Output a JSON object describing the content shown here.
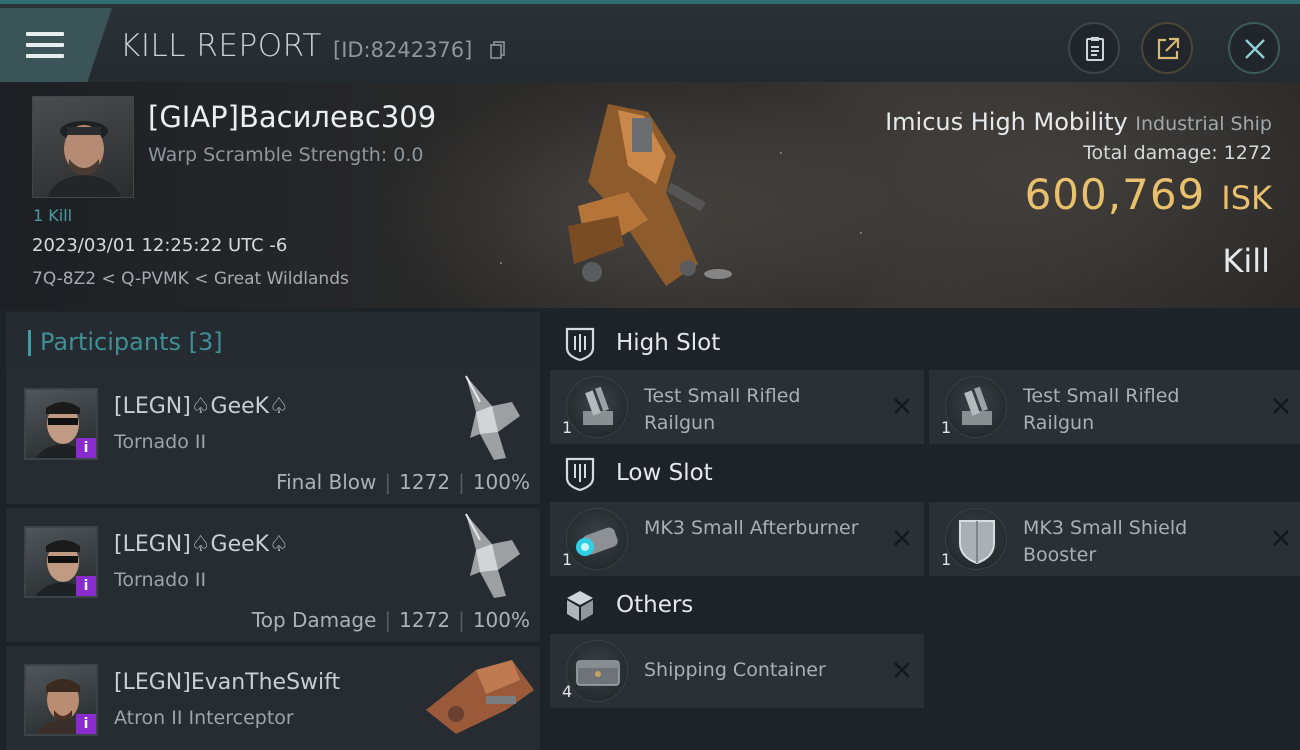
{
  "header": {
    "title": "KILL REPORT",
    "report_id": "[ID:8242376]"
  },
  "victim": {
    "name": "[GIAP]Василевс309",
    "warp_scramble": "Warp Scramble Strength: 0.0",
    "kills": "1 Kill",
    "datetime": "2023/03/01 12:25:22 UTC -6",
    "location": "7Q-8Z2 < Q-PVMK < Great Wildlands",
    "ship_name": "Imicus High Mobility",
    "ship_class": "Industrial Ship",
    "total_damage_label": "Total damage:",
    "total_damage": "1272",
    "isk_value": "600,769",
    "isk_unit": "ISK",
    "report_type": "Kill"
  },
  "participants": {
    "title": "Participants",
    "count": "[3]",
    "items": [
      {
        "name": "[LEGN]♤GeeK♤",
        "ship": "Tornado II",
        "role": "Final Blow",
        "damage": "1272",
        "percent": "100%",
        "badge": "i"
      },
      {
        "name": "[LEGN]♤GeeK♤",
        "ship": "Tornado II",
        "role": "Top Damage",
        "damage": "1272",
        "percent": "100%",
        "badge": "i"
      },
      {
        "name": "[LEGN]EvanTheSwift",
        "ship": "Atron II Interceptor",
        "role": "",
        "damage": "",
        "percent": "",
        "badge": "i"
      }
    ]
  },
  "fitting": {
    "high_slot": {
      "label": "High Slot",
      "items": [
        {
          "name": "Test Small Rifled Railgun",
          "qty": "1"
        },
        {
          "name": "Test Small Rifled Railgun",
          "qty": "1"
        }
      ]
    },
    "low_slot": {
      "label": "Low Slot",
      "items": [
        {
          "name": "MK3 Small Afterburner",
          "qty": "1"
        },
        {
          "name": "MK3 Small Shield Booster",
          "qty": "1"
        }
      ]
    },
    "others": {
      "label": "Others",
      "items": [
        {
          "name": "Shipping Container",
          "qty": "4"
        }
      ]
    }
  },
  "colors": {
    "accent_teal": "#3e9da5",
    "isk_gold": "#e9c06b",
    "badge_purple": "#8a2bd0"
  },
  "icons": [
    "menu-icon",
    "copy-icon",
    "clipboard-icon",
    "share-icon",
    "close-icon",
    "high-slot-icon",
    "low-slot-icon",
    "cargo-box-icon",
    "remove-x-icon"
  ]
}
